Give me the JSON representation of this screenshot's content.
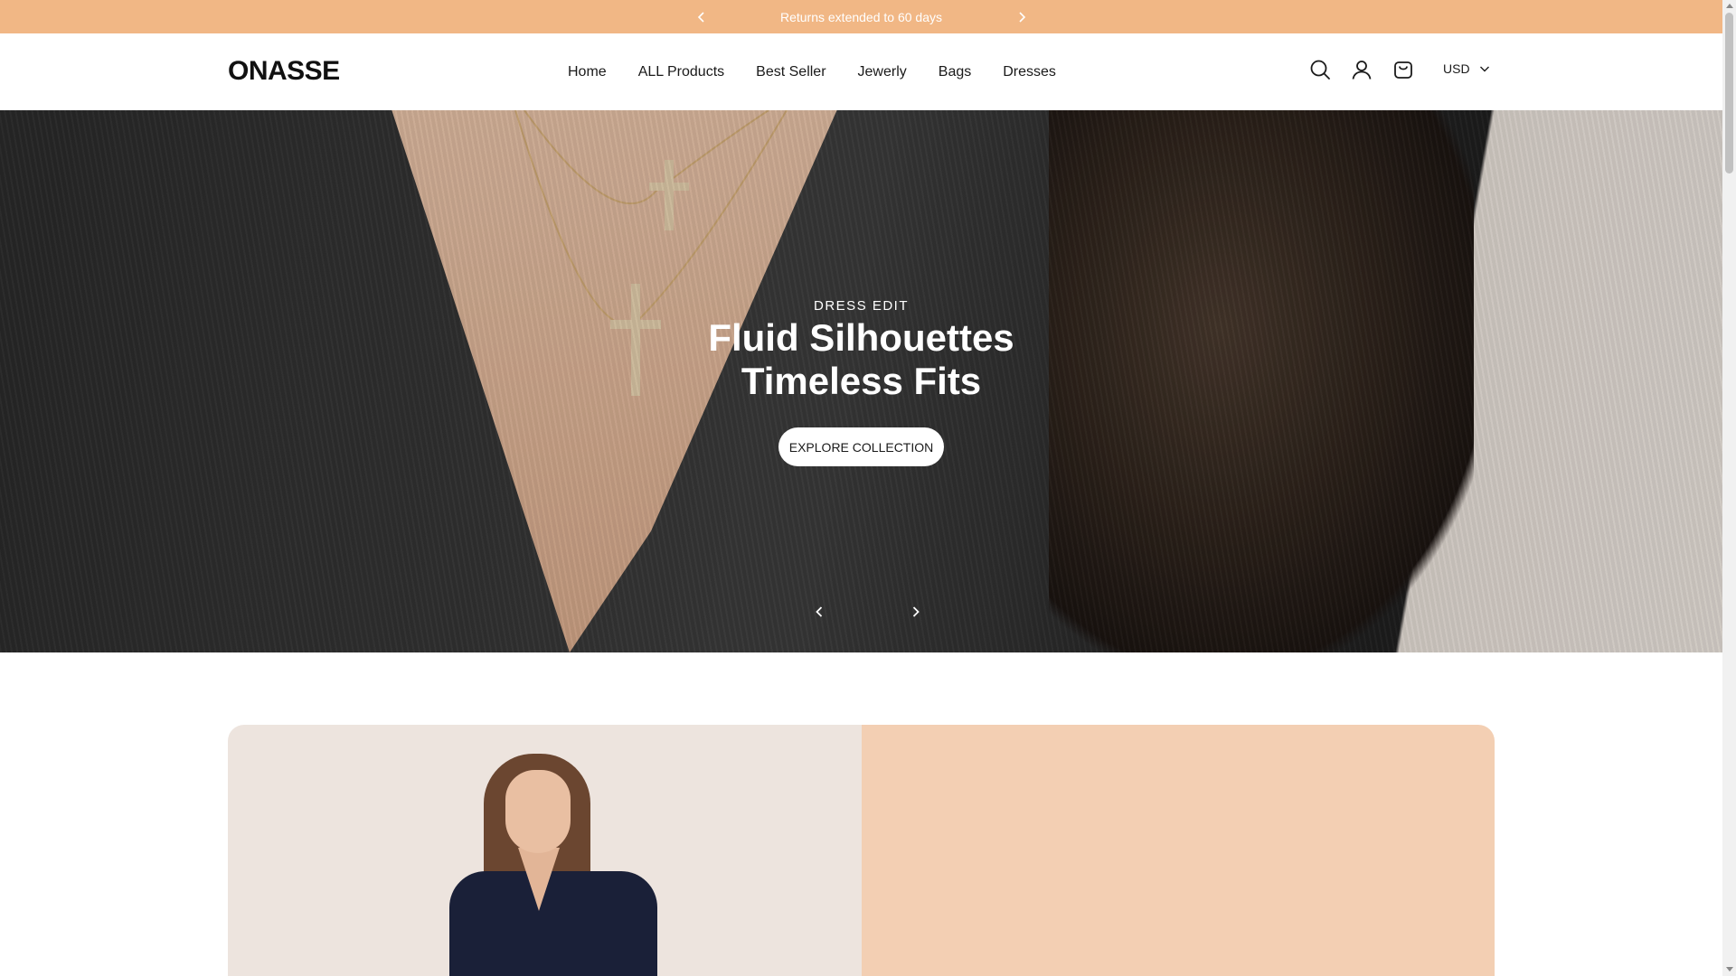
{
  "announcement": {
    "text": "Returns extended to 60 days",
    "background": "#f1b785",
    "prev_icon": "chevron-left-icon",
    "next_icon": "chevron-right-icon"
  },
  "header": {
    "logo": "ONASSE",
    "nav": [
      "Home",
      "ALL Products",
      "Best Seller",
      "Jewerly",
      "Bags",
      "Dresses"
    ],
    "icons": [
      "search-icon",
      "account-icon",
      "cart-icon"
    ],
    "currency": "USD"
  },
  "hero": {
    "eyebrow": "DRESS EDIT",
    "headline_line1": "Fluid Silhouettes",
    "headline_line2": "Timeless Fits",
    "cta": "EXPLORE COLLECTION",
    "prev_icon": "chevron-left-icon",
    "next_icon": "chevron-right-icon"
  },
  "promo": {
    "left_bg": "#ede4de",
    "right_bg": "#f3cfb3"
  }
}
